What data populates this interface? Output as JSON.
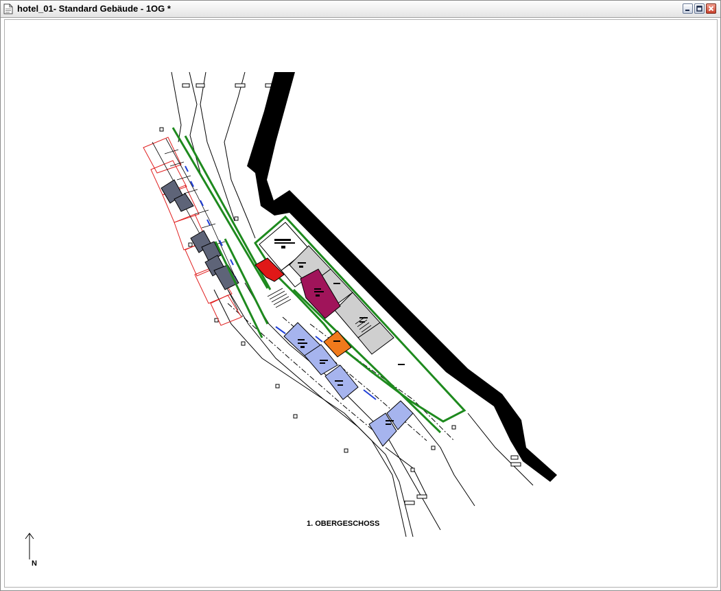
{
  "window": {
    "title": "hotel_01- Standard Gebäude - 1OG *",
    "icon": "document-icon"
  },
  "controls": {
    "minimize": "minimize-icon",
    "maximize": "maximize-icon",
    "close": "close-icon"
  },
  "drawing": {
    "floor_label": "1. OBERGESCHOSS",
    "north_label": "N",
    "colors": {
      "wall": "#000000",
      "outline": "#1e8a1e",
      "room_dark": "#5e6478",
      "room_blue": "#a6b4ee",
      "room_gray": "#cfcfcf",
      "room_magenta": "#a0145a",
      "room_red": "#e01818",
      "room_orange": "#f07a1c",
      "annotation_red": "#e02020",
      "annotation_blue": "#1f3fd8"
    }
  }
}
